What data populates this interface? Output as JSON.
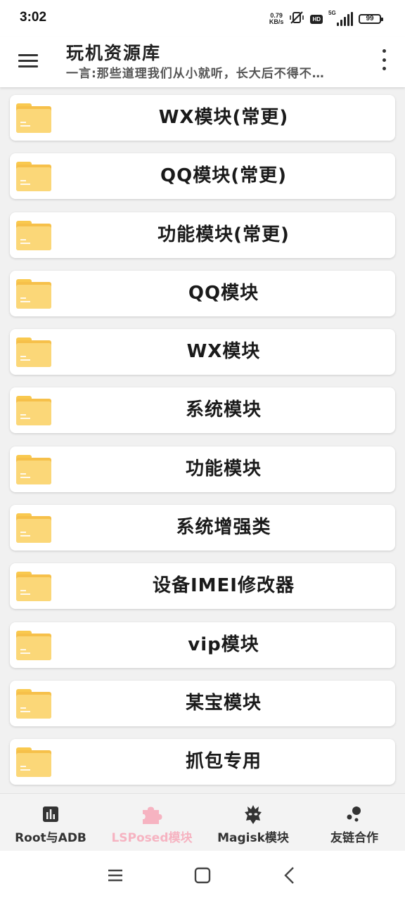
{
  "status_bar": {
    "time": "3:02",
    "net_speed_value": "0.79",
    "net_speed_unit": "KB/s",
    "hd_badge": "HD",
    "signal_label": "5G",
    "battery": "99"
  },
  "app_bar": {
    "title": "玩机资源库",
    "subtitle": "一言:那些道理我们从小就听，长大后不得不…"
  },
  "list_items": [
    {
      "label": "WX模块(常更)"
    },
    {
      "label": "QQ模块(常更)"
    },
    {
      "label": "功能模块(常更)"
    },
    {
      "label": "QQ模块"
    },
    {
      "label": "WX模块"
    },
    {
      "label": "系统模块"
    },
    {
      "label": "功能模块"
    },
    {
      "label": "系统增强类"
    },
    {
      "label": "设备IMEI修改器"
    },
    {
      "label": "vip模块"
    },
    {
      "label": "某宝模块"
    },
    {
      "label": "抓包专用"
    }
  ],
  "bottom_nav": {
    "items": [
      {
        "label": "Root与ADB",
        "icon": "bar-chart-icon"
      },
      {
        "label": "LSPosed模块",
        "icon": "puzzle-icon",
        "active": true
      },
      {
        "label": "Magisk模块",
        "icon": "magisk-mask-icon"
      },
      {
        "label": "友链合作",
        "icon": "bubbles-icon"
      }
    ]
  },
  "colors": {
    "active_tab": "#f6b3c1",
    "folder": "#fbd778",
    "folder_dark": "#f6c04a"
  }
}
